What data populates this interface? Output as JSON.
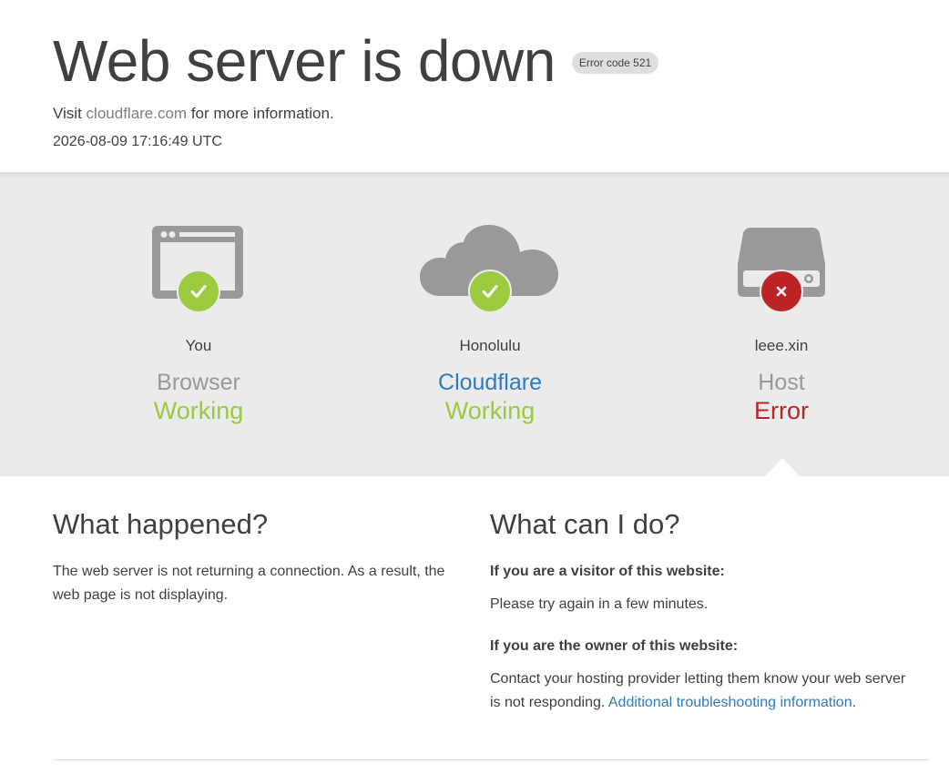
{
  "header": {
    "title": "Web server is down",
    "error_badge": "Error code 521",
    "visit_prefix": "Visit ",
    "visit_link": "cloudflare.com",
    "visit_suffix": " for more information.",
    "timestamp": "2026-08-09 17:16:49 UTC"
  },
  "status": {
    "browser": {
      "location": "You",
      "kind": "Browser",
      "state": "Working",
      "badge": "check"
    },
    "cloudflare": {
      "location": "Honolulu",
      "kind": "Cloudflare",
      "state": "Working",
      "badge": "check"
    },
    "host": {
      "location": "leee.xin",
      "kind": "Host",
      "state": "Error",
      "badge": "x"
    }
  },
  "what_happened": {
    "heading": "What happened?",
    "body": "The web server is not returning a connection. As a result, the web page is not displaying."
  },
  "what_can_i_do": {
    "heading": "What can I do?",
    "visitor_label": "If you are a visitor of this website:",
    "visitor_text": "Please try again in a few minutes.",
    "owner_label": "If you are the owner of this website:",
    "owner_text": "Contact your hosting provider letting them know your web server is not responding. ",
    "owner_link": "Additional troubleshooting information",
    "owner_end": "."
  },
  "colors": {
    "ok": "#9bca3e",
    "error": "#bd2426",
    "link": "#2f7bbf",
    "icon_gray": "#999999"
  }
}
